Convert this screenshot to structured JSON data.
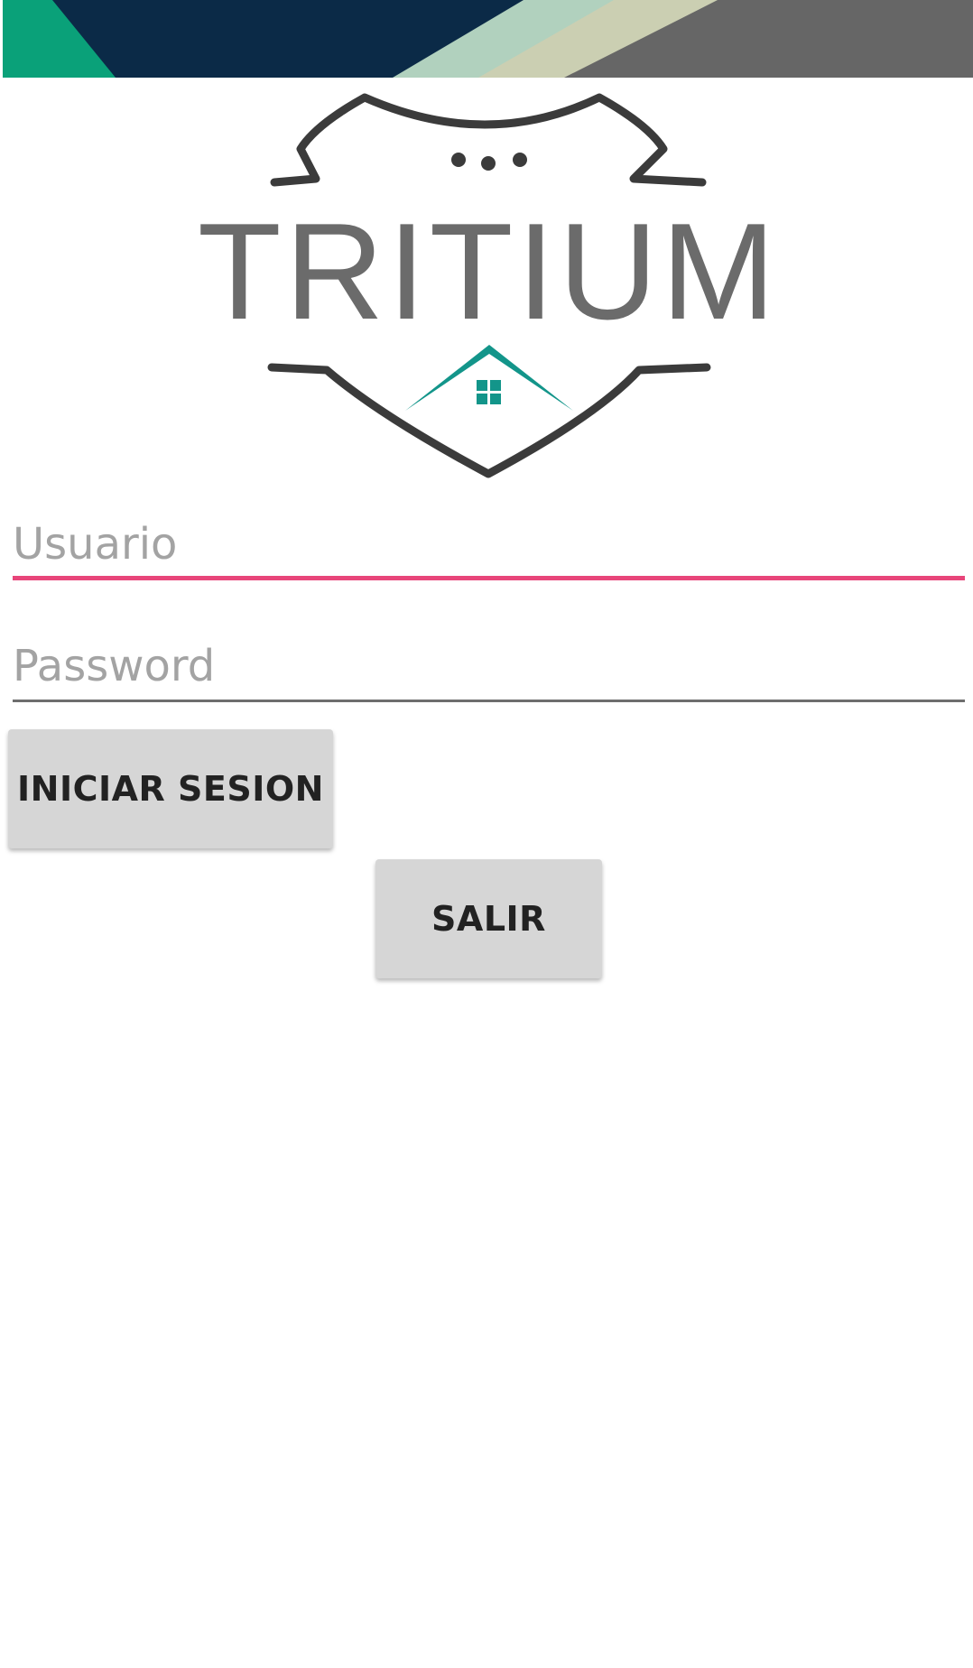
{
  "app": {
    "logo_text": "TRITIUM",
    "colors": {
      "banner_green": "#0aa179",
      "banner_navy": "#0b2a47",
      "banner_mint": "#b1d1be",
      "banner_sand": "#cbcfb2",
      "banner_gray": "#666666",
      "logo_outline": "#3b3b3b",
      "logo_text": "#6b6b6b",
      "house_teal": "#13958a",
      "focus_underline": "#e8457a",
      "button_bg": "#d6d6d6"
    }
  },
  "login": {
    "username": {
      "placeholder": "Usuario",
      "value": ""
    },
    "password": {
      "placeholder": "Password",
      "value": ""
    },
    "login_button_label": "INICIAR SESION",
    "exit_button_label": "SALIR"
  }
}
